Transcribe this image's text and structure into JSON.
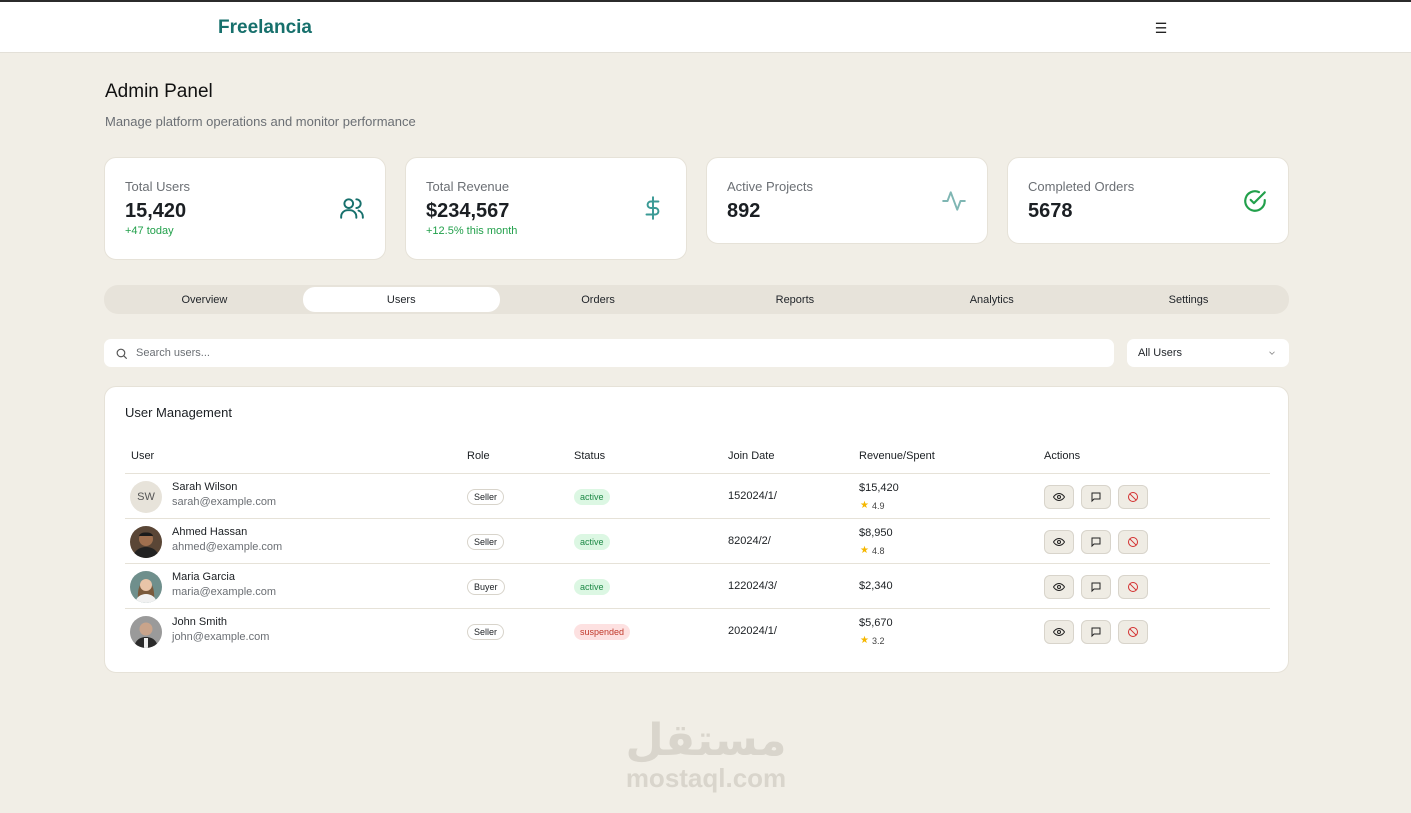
{
  "header": {
    "brand": "Freelancia",
    "menu_icon": "hamburger-menu-icon"
  },
  "page": {
    "title": "Admin Panel",
    "subtitle": "Manage platform operations and monitor performance"
  },
  "stats": [
    {
      "label": "Total Users",
      "value": "15,420",
      "delta": "+47 today",
      "icon": "users-icon",
      "icon_color": "#17706c"
    },
    {
      "label": "Total Revenue",
      "value": "$234,567",
      "delta": "+12.5% this month",
      "icon": "dollar-icon",
      "icon_color": "#3a9a95"
    },
    {
      "label": "Active Projects",
      "value": "892",
      "icon": "activity-icon",
      "icon_color": "#7fb6b3"
    },
    {
      "label": "Completed Orders",
      "value": "5678",
      "icon": "check-circle-icon",
      "icon_color": "#22a04b"
    }
  ],
  "tabs": [
    {
      "label": "Overview",
      "active": false
    },
    {
      "label": "Users",
      "active": true
    },
    {
      "label": "Orders",
      "active": false
    },
    {
      "label": "Reports",
      "active": false
    },
    {
      "label": "Analytics",
      "active": false
    },
    {
      "label": "Settings",
      "active": false
    }
  ],
  "search": {
    "placeholder": "Search users...",
    "value": ""
  },
  "filter": {
    "selected": "All Users"
  },
  "table": {
    "title": "User Management",
    "columns": [
      "User",
      "Role",
      "Status",
      "Join Date",
      "Revenue/Spent",
      "Actions"
    ],
    "rows": [
      {
        "name": "Sarah Wilson",
        "email": "sarah@example.com",
        "initials": "SW",
        "role": "Seller",
        "status": "active",
        "join": "152024/1/",
        "revenue": "$15,420",
        "rating": "4.9"
      },
      {
        "name": "Ahmed Hassan",
        "email": "ahmed@example.com",
        "initials": "",
        "role": "Seller",
        "status": "active",
        "join": "82024/2/",
        "revenue": "$8,950",
        "rating": "4.8"
      },
      {
        "name": "Maria Garcia",
        "email": "maria@example.com",
        "initials": "",
        "role": "Buyer",
        "status": "active",
        "join": "122024/3/",
        "revenue": "$2,340",
        "rating": ""
      },
      {
        "name": "John Smith",
        "email": "john@example.com",
        "initials": "",
        "role": "Seller",
        "status": "suspended",
        "join": "202024/1/",
        "revenue": "$5,670",
        "rating": "3.2"
      }
    ],
    "action_icons": [
      "eye-icon",
      "message-icon",
      "ban-icon"
    ]
  },
  "watermark": {
    "arabic": "مستقل",
    "latin": "mostaql.com"
  }
}
